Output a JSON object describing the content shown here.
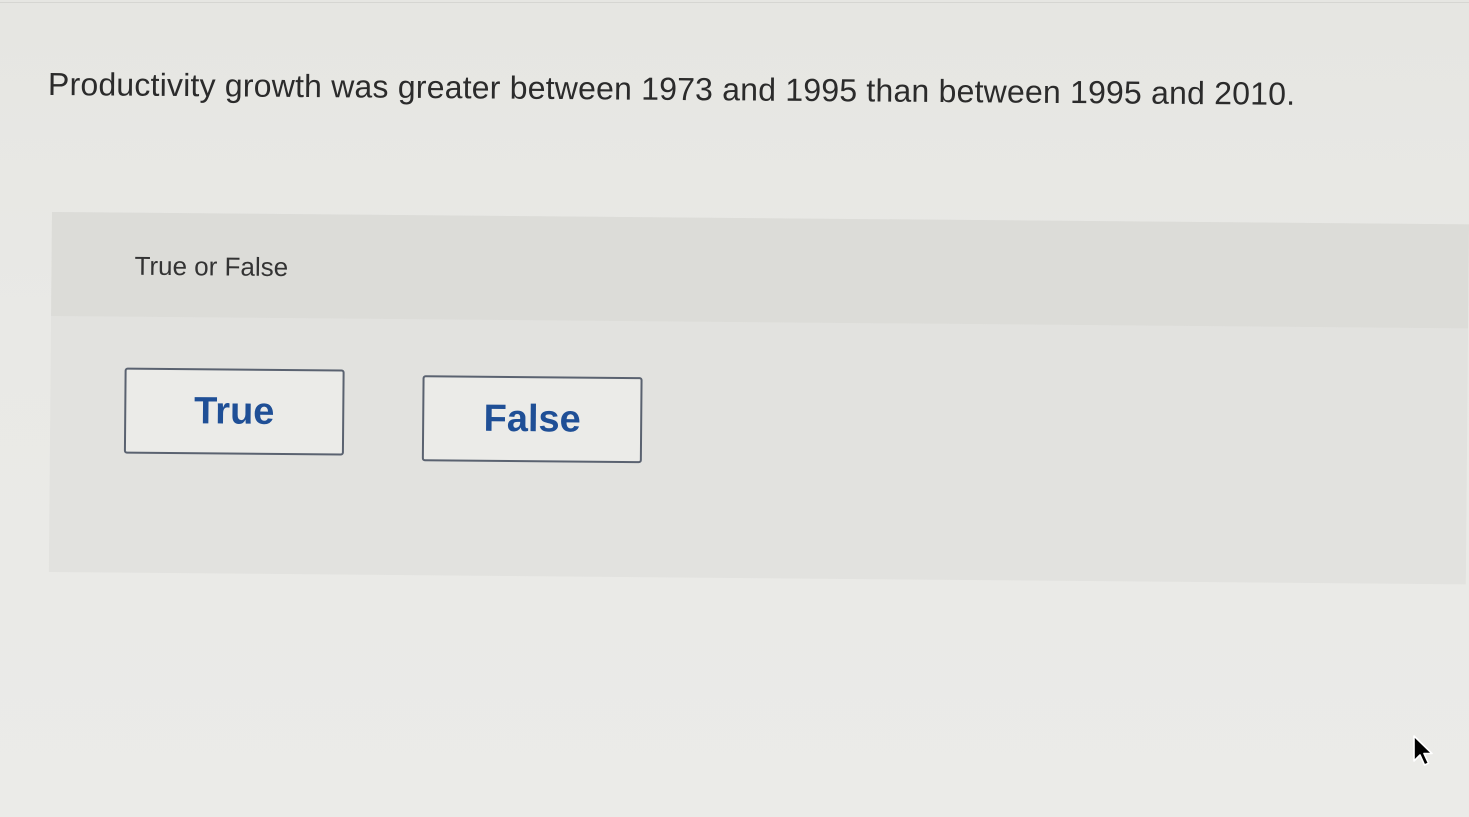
{
  "question": {
    "text": "Productivity growth was greater between 1973 and 1995 than between 1995 and 2010."
  },
  "answer_panel": {
    "instruction": "True or False",
    "options": [
      {
        "label": "True"
      },
      {
        "label": "False"
      }
    ]
  },
  "colors": {
    "button_text": "#1f4f96",
    "button_border": "#5a6270",
    "question_text": "#2b2b2b"
  },
  "icons": {
    "cursor": "mouse-pointer-icon"
  }
}
